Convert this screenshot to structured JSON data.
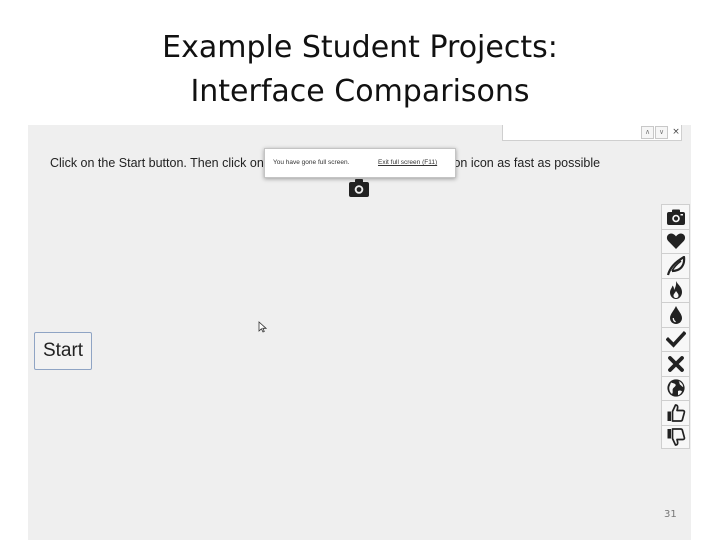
{
  "slide": {
    "title_line1": "Example Student Projects:",
    "title_line2": "Interface Comparisons",
    "page_number": "31"
  },
  "browser": {
    "find_bar": {
      "up_glyph": "∧",
      "down_glyph": "∨",
      "close_glyph": "×"
    },
    "fullscreen_popup": {
      "message": "You have gone full screen.",
      "exit_link": "Exit full screen (F11)"
    }
  },
  "app": {
    "instruction": "Click on the Start button. Then click on the icon that matches the instruction icon as fast as possible",
    "instruction_icon": "camera-icon",
    "start_button": "Start",
    "toolbar_icons": [
      "camera-icon",
      "heart-icon",
      "leaf-icon",
      "fire-icon",
      "drop-icon",
      "check-icon",
      "x-icon",
      "globe-icon",
      "thumbs-up-icon",
      "thumbs-down-icon"
    ]
  }
}
